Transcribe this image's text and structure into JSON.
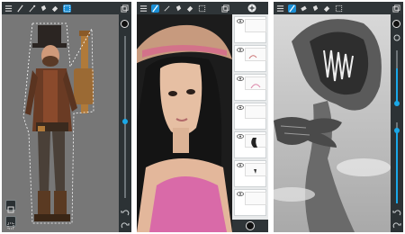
{
  "screens": [
    {
      "name": "steampunk-character",
      "toolbar": {
        "icons": [
          "menu-icon",
          "brush-icon",
          "pen-icon",
          "fill-icon",
          "paint-bucket-icon",
          "selection-icon",
          "layers-icon"
        ]
      },
      "brush_slider_level": 0.45,
      "colors": {
        "canvas_bg": "#767676",
        "accent": "#1a8fd6"
      }
    },
    {
      "name": "portrait-girl-layers",
      "toolbar": {
        "icons": [
          "menu-icon",
          "pen-icon",
          "smudge-icon",
          "fill-icon",
          "paint-bucket-icon",
          "selection-icon",
          "layers-icon"
        ]
      },
      "layers": [
        {
          "caption": ""
        },
        {
          "caption": ""
        },
        {
          "caption": ""
        },
        {
          "caption": ""
        },
        {
          "caption": ""
        },
        {
          "caption": ""
        },
        {
          "caption": ""
        }
      ],
      "colors": {
        "accent": "#1a8fd6"
      }
    },
    {
      "name": "creature-sketch",
      "toolbar": {
        "icons": [
          "menu-icon",
          "pen-icon",
          "eraser-icon",
          "fill-icon",
          "paint-bucket-icon",
          "selection-icon",
          "layers-icon"
        ]
      },
      "brush_slider_level": 0.62,
      "colors": {
        "canvas_bg": "#bdbdbd",
        "accent": "#1aa8e8"
      }
    }
  ]
}
